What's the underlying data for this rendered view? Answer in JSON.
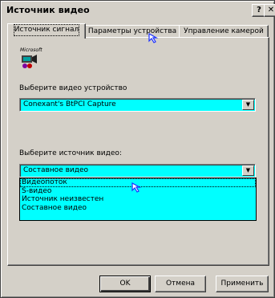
{
  "window": {
    "title": "Источник видео",
    "help_label": "?",
    "close_label": "✕"
  },
  "tabs": [
    {
      "label": "Источник сигнал"
    },
    {
      "label": "Параметры устройства"
    },
    {
      "label": "Управление камерой"
    }
  ],
  "panel": {
    "logo_text": "Microsoft",
    "device_label": "Выберите видео устройство",
    "device_value": "Conexant's BtPCI Capture",
    "source_label": "Выберите источник видео:",
    "source_value": "Составное видео",
    "source_options": [
      "Видеопоток",
      "S-видео",
      "Источник неизвестен",
      "Составное видео"
    ]
  },
  "buttons": {
    "ok": "OK",
    "cancel": "Отмена",
    "apply": "Применить"
  },
  "colors": {
    "window_bg": "#d4d0c8",
    "field_bg": "#00ffff",
    "cursor": "#1a2fff"
  }
}
